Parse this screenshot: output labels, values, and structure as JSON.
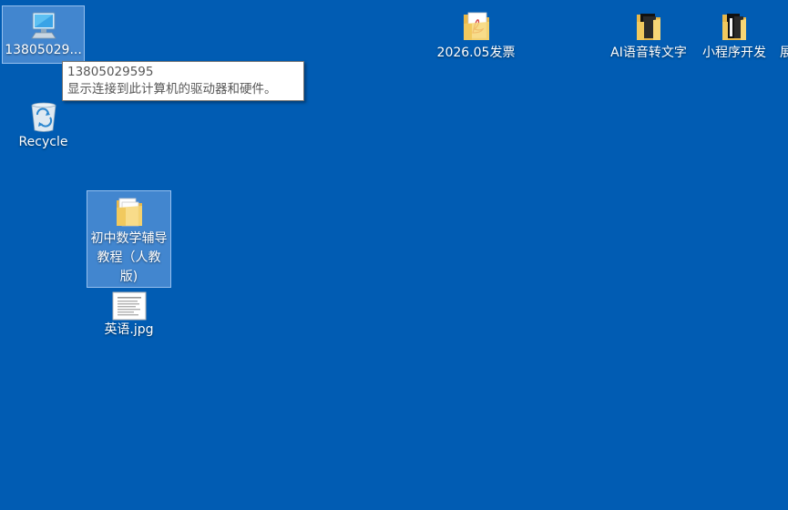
{
  "desktop": {
    "background_color": "#015cb3",
    "icons": [
      {
        "label": "13805029...",
        "icon": "computer-icon"
      },
      {
        "label": "Recycle",
        "icon": "recycle-bin-icon"
      },
      {
        "label": "初中数学辅导教程（人教版)",
        "icon": "folder-icon"
      },
      {
        "label": "英语.jpg",
        "icon": "image-file-icon"
      },
      {
        "label": "2026.05发票",
        "icon": "pdf-folder-icon"
      },
      {
        "label": "AI语音转文字",
        "icon": "folder-icon"
      },
      {
        "label": "小程序开发",
        "icon": "folder-icon"
      },
      {
        "label": "展",
        "icon": "text-fragment"
      }
    ]
  },
  "tooltip": {
    "title": "13805029595",
    "description": "显示连接到此计算机的驱动器和硬件。"
  }
}
